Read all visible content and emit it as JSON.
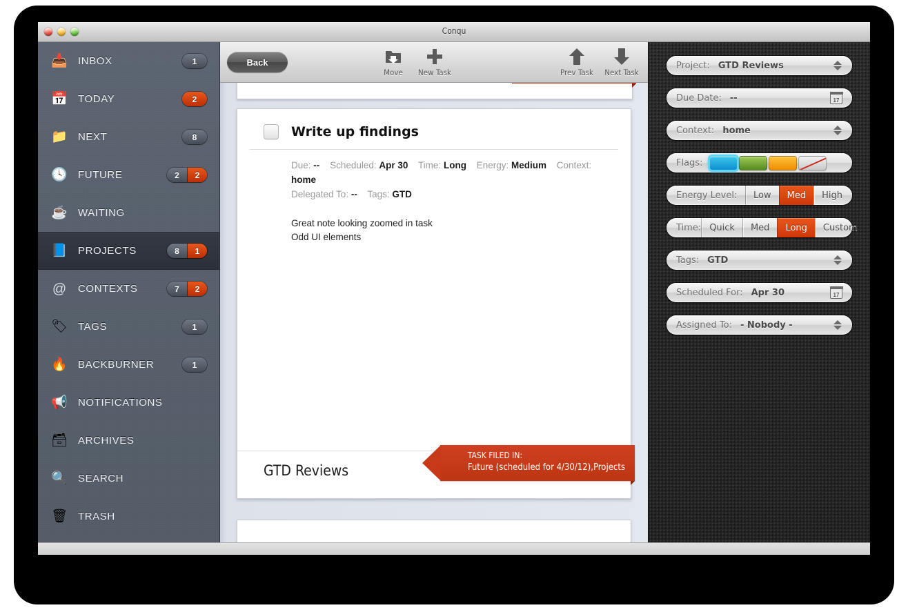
{
  "window": {
    "title": "Conqu",
    "traffic_lights": [
      "close-button",
      "minimize-button",
      "zoom-button"
    ]
  },
  "sidebar": {
    "items": [
      {
        "label": "INBOX",
        "icon": "inbox-tray-icon",
        "glyph": "📥",
        "badge": "1",
        "badge_alert": null,
        "selected": false
      },
      {
        "label": "TODAY",
        "icon": "calendar-icon",
        "glyph": "📅",
        "badge": null,
        "badge_alert": "2",
        "selected": false
      },
      {
        "label": "NEXT",
        "icon": "folder-bookmark-icon",
        "glyph": "📁",
        "badge": "8",
        "badge_alert": null,
        "selected": false
      },
      {
        "label": "FUTURE",
        "icon": "clock-icon",
        "glyph": "🕓",
        "badge": "2",
        "badge_alert": "2",
        "selected": false
      },
      {
        "label": "WAITING",
        "icon": "coffee-cup-icon",
        "glyph": "☕",
        "badge": null,
        "badge_alert": null,
        "selected": false
      },
      {
        "label": "PROJECTS",
        "icon": "project-book-icon",
        "glyph": "📘",
        "badge": "8",
        "badge_alert": "1",
        "selected": true
      },
      {
        "label": "CONTEXTS",
        "icon": "at-sign-icon",
        "glyph": "@",
        "badge": "7",
        "badge_alert": "2",
        "selected": false
      },
      {
        "label": "TAGS",
        "icon": "tags-icon",
        "glyph": "🏷",
        "badge": "1",
        "badge_alert": null,
        "selected": false
      },
      {
        "label": "BACKBURNER",
        "icon": "flame-icon",
        "glyph": "🔥",
        "badge": "1",
        "badge_alert": null,
        "selected": false
      },
      {
        "label": "NOTIFICATIONS",
        "icon": "megaphone-icon",
        "glyph": "📢",
        "badge": null,
        "badge_alert": null,
        "selected": false
      },
      {
        "label": "ARCHIVES",
        "icon": "archive-box-icon",
        "glyph": "🗃",
        "badge": null,
        "badge_alert": null,
        "selected": false
      },
      {
        "label": "SEARCH",
        "icon": "magnifier-icon",
        "glyph": "🔍",
        "badge": null,
        "badge_alert": null,
        "selected": false
      },
      {
        "label": "TRASH",
        "icon": "trash-can-icon",
        "glyph": "🗑",
        "badge": null,
        "badge_alert": null,
        "selected": false
      }
    ]
  },
  "toolbar": {
    "back_label": "Back",
    "move_label": "Move",
    "new_task_label": "New Task",
    "prev_task_label": "Prev Task",
    "next_task_label": "Next Task"
  },
  "task_card": {
    "title": "Write up findings",
    "checkbox_checked": false,
    "meta": {
      "due_key": "Due:",
      "due_value": "--",
      "scheduled_key": "Scheduled:",
      "scheduled_value": "Apr 30",
      "time_key": "Time:",
      "time_value": "Long",
      "energy_key": "Energy:",
      "energy_value": "Medium",
      "context_key": "Context:",
      "context_value": "home",
      "delegated_key": "Delegated To:",
      "delegated_value": "--",
      "tags_key": "Tags:",
      "tags_value": "GTD"
    },
    "note_line_1": "Great note looking zoomed in task",
    "note_line_2": "Odd UI elements",
    "footer_project": "GTD Reviews",
    "ribbon_line_1": "TASK FILED IN:",
    "ribbon_line_2": "Future (scheduled for 4/30/12),Projects"
  },
  "inspector": {
    "project": {
      "label": "Project:",
      "value": "GTD Reviews"
    },
    "due_date": {
      "label": "Due Date:",
      "value": "--"
    },
    "context": {
      "label": "Context:",
      "value": "home"
    },
    "flags": {
      "label": "Flags:",
      "swatches": [
        "blue",
        "green",
        "orange",
        "none"
      ],
      "selected_index": 0
    },
    "energy_level": {
      "label": "Energy Level:",
      "options": [
        "Low",
        "Med",
        "High"
      ],
      "selected": "Med"
    },
    "time": {
      "label": "Time:",
      "options": [
        "Quick",
        "Med",
        "Long",
        "Custom"
      ],
      "selected": "Long"
    },
    "tags": {
      "label": "Tags:",
      "value": "GTD"
    },
    "scheduled_for": {
      "label": "Scheduled For:",
      "value": "Apr 30"
    },
    "assigned_to": {
      "label": "Assigned To:",
      "value": "- Nobody -"
    }
  },
  "colors": {
    "accent_red": "#cf3708",
    "sidebar": "#555e69",
    "inspector_bg": "#262626",
    "content_bg": "#e3e7ee",
    "flag_blue": "#0b8fd0",
    "flag_green": "#56891f",
    "flag_orange": "#f08c00"
  }
}
